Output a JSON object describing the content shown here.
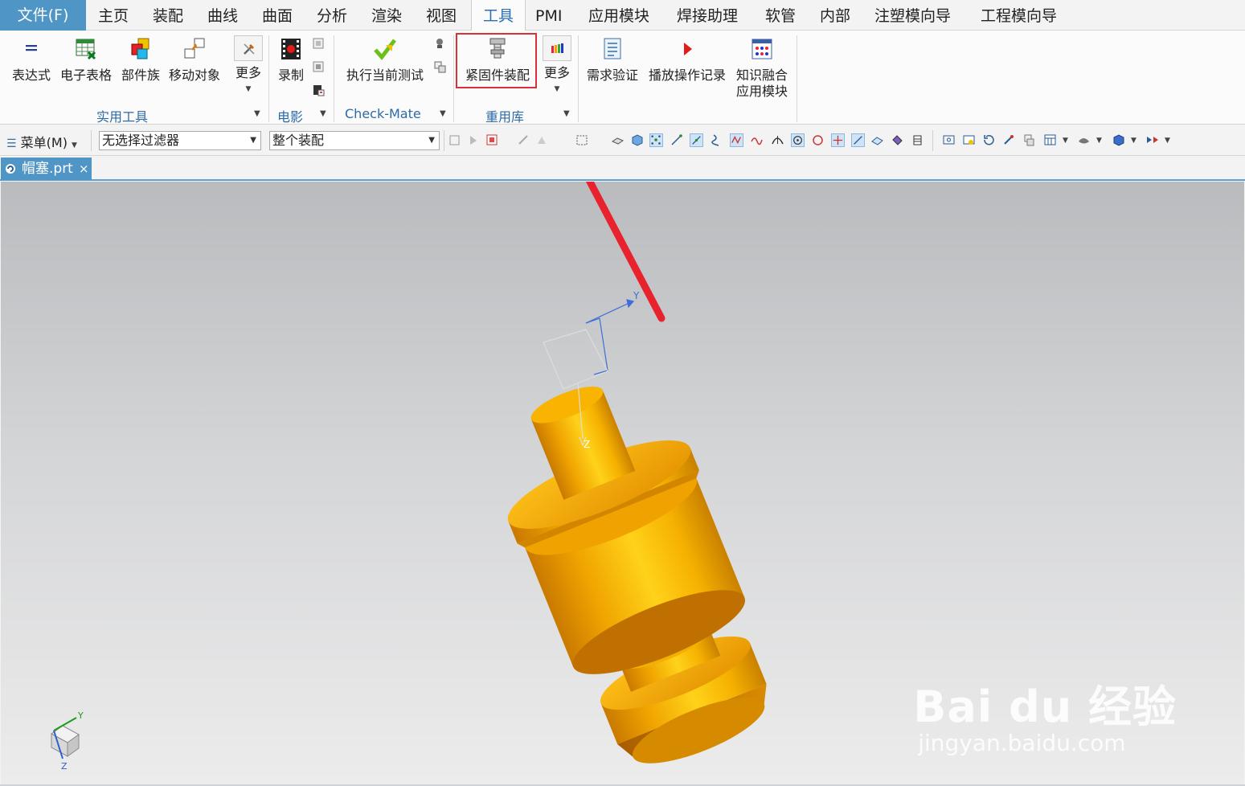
{
  "menubar": {
    "file": "文件(F)",
    "items": [
      "主页",
      "装配",
      "曲线",
      "曲面",
      "分析",
      "渲染",
      "视图",
      "工具",
      "PMI",
      "应用模块",
      "焊接助理",
      "软管",
      "内部",
      "注塑模向导",
      "工程模向导"
    ],
    "active_index": 7
  },
  "ribbon": {
    "utilities": {
      "expression": "表达式",
      "spreadsheet": "电子表格",
      "part_family": "部件族",
      "move_object": "移动对象",
      "more": "更多",
      "group": "实用工具"
    },
    "movie": {
      "record": "录制",
      "group": "电影"
    },
    "checkmate": {
      "run_test": "执行当前测试",
      "group": "Check-Mate"
    },
    "reuse": {
      "fastener_assembly": "紧固件装配",
      "more": "更多",
      "group": "重用库"
    },
    "requirements": {
      "verify": "需求验证",
      "playback": "播放操作记录",
      "kf_line1": "知识融合",
      "kf_line2": "应用模块"
    }
  },
  "toolbar": {
    "menu": "菜单(M)",
    "filter_value": "无选择过滤器",
    "scope_value": "整个装配"
  },
  "tab": {
    "name": "帽塞.prt",
    "close": "×"
  },
  "viewport": {
    "csys_y": "Y",
    "csys_z": "Z",
    "triad_y": "Y",
    "triad_z": "Z"
  },
  "watermark": {
    "brand": "Bai du 经验",
    "url": "jingyan.baidu.com"
  },
  "colors": {
    "accent": "#4f95c6",
    "part": "#f5a70a",
    "highlight": "#d8313a",
    "arrow": "#e8232d"
  }
}
